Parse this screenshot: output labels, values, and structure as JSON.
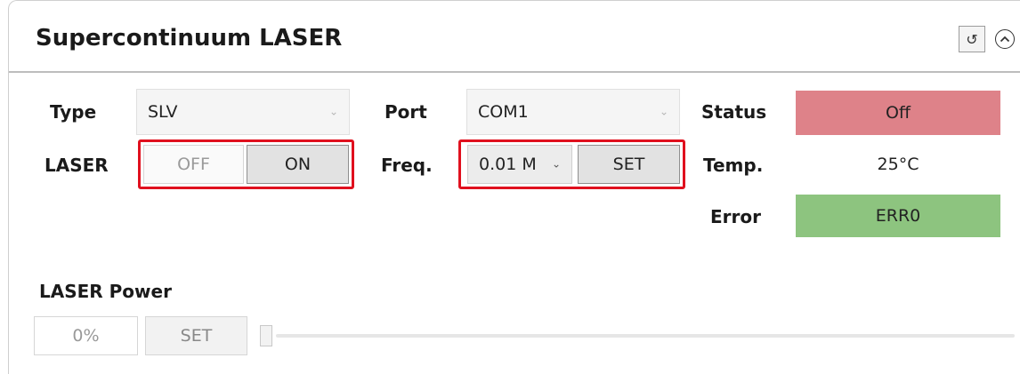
{
  "panel": {
    "title": "Supercontinuum LASER",
    "icons": {
      "refresh": "refresh-icon",
      "collapse": "chevron-up-circle-icon"
    }
  },
  "type": {
    "label": "Type",
    "selected": "SLV"
  },
  "port": {
    "label": "Port",
    "selected": "COM1"
  },
  "status": {
    "label": "Status",
    "value": "Off",
    "color": "#de8289"
  },
  "laser": {
    "label": "LASER",
    "off_label": "OFF",
    "on_label": "ON"
  },
  "freq": {
    "label": "Freq.",
    "selected": "0.01 M",
    "set_label": "SET"
  },
  "temp": {
    "label": "Temp.",
    "value": "25°C"
  },
  "error": {
    "label": "Error",
    "value": "ERR0",
    "color": "#8dc47f"
  },
  "power": {
    "label": "LASER Power",
    "value": "0%",
    "set_label": "SET",
    "slider_percent": 0
  },
  "highlight_color": "#e0101e"
}
